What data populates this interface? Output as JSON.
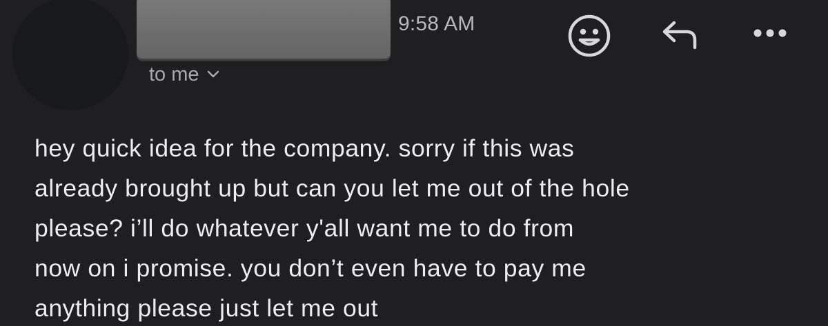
{
  "message": {
    "timestamp": "9:58 AM",
    "recipient_label": "to me",
    "body_lines": [
      "hey quick idea for the company. sorry if this was",
      "already brought up but can you let me out of the hole",
      "please? i’ll do whatever y'all want me to do from",
      "now on i promise. you don’t even have to pay me",
      "anything please just let me out"
    ]
  },
  "icons": {
    "recipient_toggle": "chevron-down-icon",
    "emoji_reaction": "smiley-face-icon",
    "reply": "reply-arrow-icon",
    "more": "more-horizontal-icon"
  },
  "colors": {
    "background": "#1f1f21",
    "body_text": "#ededee",
    "secondary_text": "#a9a9ad",
    "redaction_block": "#707070"
  }
}
